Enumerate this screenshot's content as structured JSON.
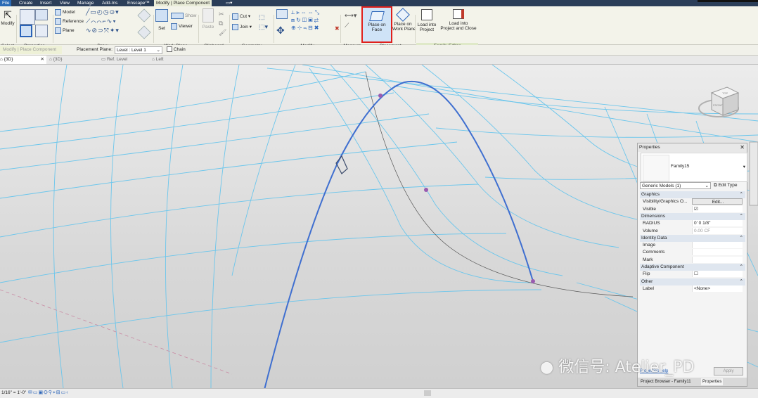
{
  "tabs": [
    "File",
    "Create",
    "Insert",
    "View",
    "Manage",
    "Add-Ins",
    "Enscape™",
    "Modify | Place Component"
  ],
  "ribbon": {
    "select": {
      "modify": "Modify",
      "group": "Select"
    },
    "properties_group": "Properties",
    "draw": {
      "model": "Model",
      "reference": "Reference",
      "plane": "Plane",
      "group": "Draw"
    },
    "work_plane": {
      "set": "Set",
      "show": "Show",
      "viewer": "Viewer",
      "group": "Work Plane"
    },
    "clipboard": {
      "paste": "Paste",
      "group": "Clipboard"
    },
    "geometry": {
      "cut": "Cut",
      "join": "Join",
      "group": "Geometry"
    },
    "modify_group": "Modify",
    "measure_group": "Measure",
    "placement": {
      "place_on_face_1": "Place on",
      "place_on_face_2": "Face",
      "place_on_wp_1": "Place on",
      "place_on_wp_2": "Work Plane",
      "group": "Placement"
    },
    "family_editor": {
      "load_1": "Load into",
      "load_2": "Project",
      "load_close_1": "Load into",
      "load_close_2": "Project and Close",
      "group": "Family Editor"
    }
  },
  "options_bar": {
    "context": "Modify | Place Component",
    "placement_plane_label": "Placement Plane:",
    "placement_plane_value": "Level : Level 1",
    "chain": "Chain"
  },
  "view_tabs": [
    "{3D}",
    "{3D}",
    "Ref. Level",
    "Left"
  ],
  "properties": {
    "title": "Properties",
    "family_name": "Family15",
    "type_selector": "Generic Models (1)",
    "edit_type": "Edit Type",
    "rows": [
      {
        "kind": "cat",
        "name": "Graphics"
      },
      {
        "kind": "row",
        "name": "Visibility/Graphics O...",
        "value": "Edit..."
      },
      {
        "kind": "row",
        "name": "Visible",
        "value": "☑"
      },
      {
        "kind": "cat",
        "name": "Dimensions"
      },
      {
        "kind": "row",
        "name": "RADIUS",
        "value": "0'  0 1/8\""
      },
      {
        "kind": "row",
        "name": "Volume",
        "value": "0.00 CF"
      },
      {
        "kind": "cat",
        "name": "Identity Data"
      },
      {
        "kind": "row",
        "name": "Image",
        "value": ""
      },
      {
        "kind": "row",
        "name": "Comments",
        "value": ""
      },
      {
        "kind": "row",
        "name": "Mark",
        "value": ""
      },
      {
        "kind": "cat",
        "name": "Adaptive Component"
      },
      {
        "kind": "row",
        "name": "Flip",
        "value": "☐"
      },
      {
        "kind": "cat",
        "name": "Other"
      },
      {
        "kind": "row",
        "name": "Label",
        "value": "<None>"
      }
    ],
    "help_link": "Properties help",
    "apply": "Apply",
    "bottom_tabs": [
      "Project Browser - Family11",
      "Properties"
    ]
  },
  "viewcube": {
    "top": "TOP",
    "front": "FRONT"
  },
  "watermark": "微信号: Atelier_PD",
  "status": {
    "scale": "1/16\" = 1'-0\""
  },
  "colors": {
    "highlight": "#e0201c",
    "curve": "#3f6fd0",
    "mesh": "#6bc6ec",
    "point": "#9a5bb0"
  }
}
